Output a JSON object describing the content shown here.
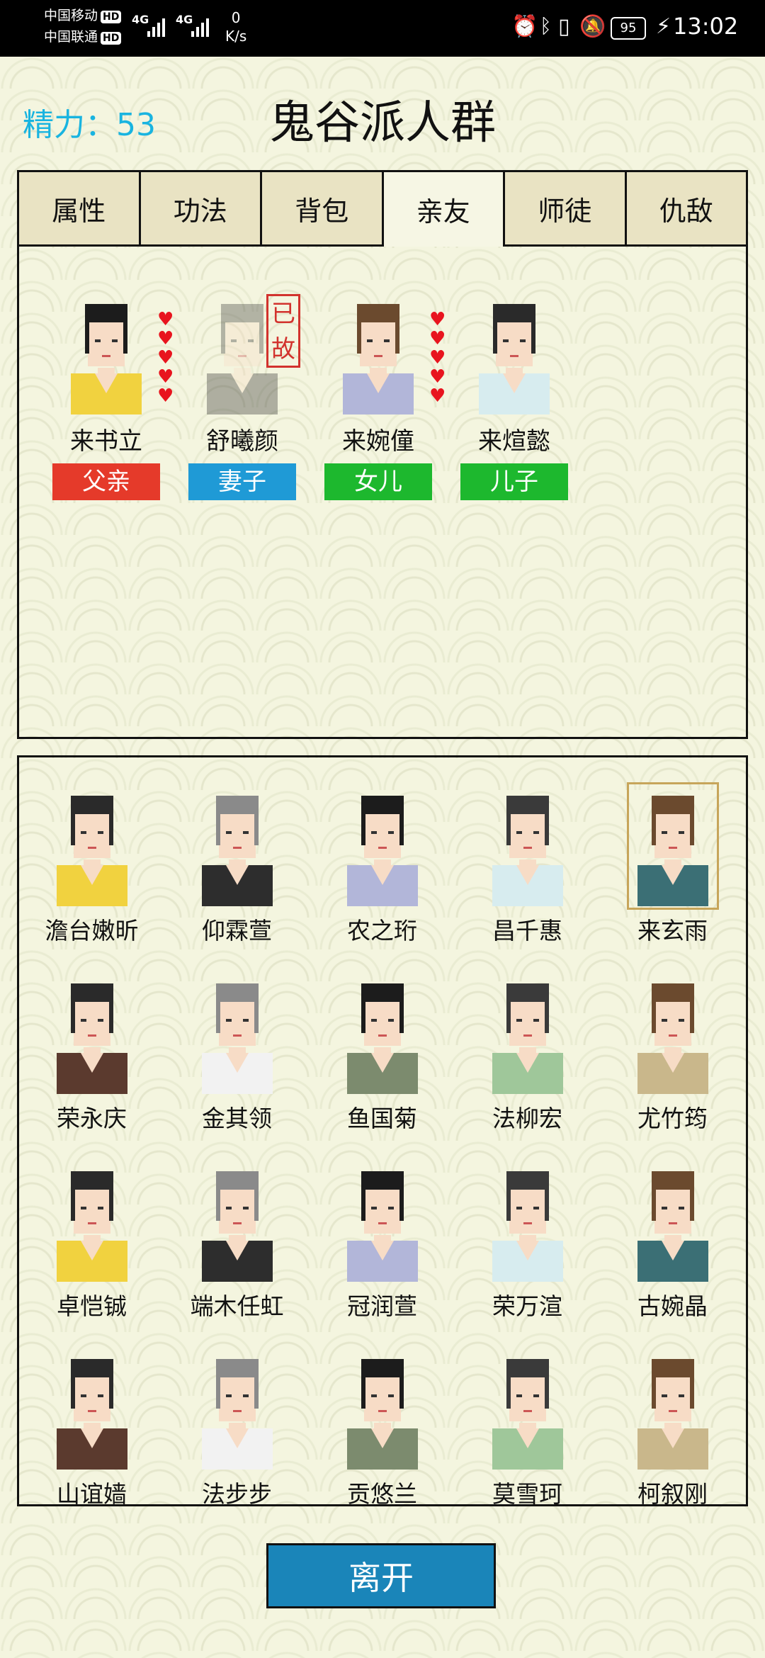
{
  "status_bar": {
    "carrier1": "中国移动",
    "carrier2": "中国联通",
    "hd": "HD",
    "net": "4G",
    "speed_value": "0",
    "speed_unit": "K/s",
    "battery": "95",
    "time": "13:02"
  },
  "header": {
    "energy": "精力：53",
    "title": "鬼谷派人群"
  },
  "tabs": [
    {
      "label": "属性"
    },
    {
      "label": "功法"
    },
    {
      "label": "背包"
    },
    {
      "label": "亲友"
    },
    {
      "label": "师徒"
    },
    {
      "label": "仇敌"
    }
  ],
  "active_tab": "亲友",
  "relatives": [
    {
      "name": "来书立",
      "relation": "父亲",
      "badge_color": "#e53a2a",
      "hearts": 5,
      "deceased": false
    },
    {
      "name": "舒曦颜",
      "relation": "妻子",
      "badge_color": "#1f9ad6",
      "hearts": 0,
      "deceased": true,
      "deceased_label": "已故"
    },
    {
      "name": "来婉僮",
      "relation": "女儿",
      "badge_color": "#1db82e",
      "hearts": 5,
      "deceased": false
    },
    {
      "name": "来煊懿",
      "relation": "儿子",
      "badge_color": "#1db82e",
      "hearts": 0,
      "deceased": false
    }
  ],
  "heart_glyph": "♥",
  "roster": [
    {
      "name": "澹台嫩昕"
    },
    {
      "name": "仰霖萱"
    },
    {
      "name": "农之珩"
    },
    {
      "name": "昌千惠"
    },
    {
      "name": "来玄雨",
      "selected": true
    },
    {
      "name": "荣永庆"
    },
    {
      "name": "金其领"
    },
    {
      "name": "鱼国菊"
    },
    {
      "name": "法柳宏"
    },
    {
      "name": "尤竹筠"
    },
    {
      "name": "卓恺铖"
    },
    {
      "name": "端木任虹"
    },
    {
      "name": "冠润萱"
    },
    {
      "name": "荣万渲"
    },
    {
      "name": "古婉晶"
    },
    {
      "name": "山谊嫱"
    },
    {
      "name": "法步步"
    },
    {
      "name": "贡悠兰"
    },
    {
      "name": "莫雪珂"
    },
    {
      "name": "柯叙刚"
    }
  ],
  "leave_button": "离开"
}
